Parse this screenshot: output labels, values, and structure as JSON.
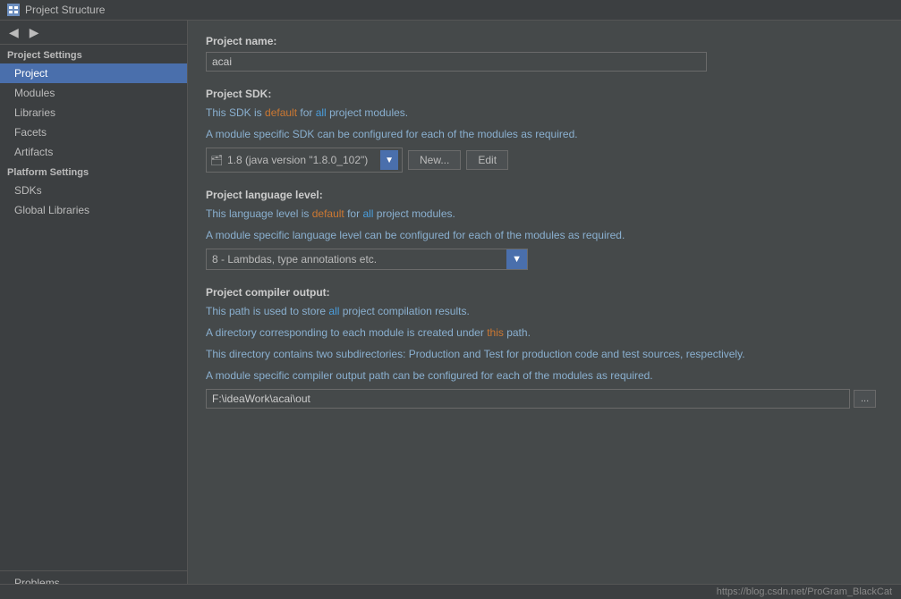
{
  "titleBar": {
    "icon": "project-icon",
    "title": "Project Structure"
  },
  "sidebar": {
    "backBtn": "◀",
    "forwardBtn": "▶",
    "projectSettingsLabel": "Project Settings",
    "items": [
      {
        "id": "project",
        "label": "Project",
        "active": true
      },
      {
        "id": "modules",
        "label": "Modules",
        "active": false
      },
      {
        "id": "libraries",
        "label": "Libraries",
        "active": false
      },
      {
        "id": "facets",
        "label": "Facets",
        "active": false
      },
      {
        "id": "artifacts",
        "label": "Artifacts",
        "active": false
      }
    ],
    "platformSettingsLabel": "Platform Settings",
    "platformItems": [
      {
        "id": "sdks",
        "label": "SDKs",
        "active": false
      },
      {
        "id": "global-libraries",
        "label": "Global Libraries",
        "active": false
      }
    ],
    "problemsLabel": "Problems"
  },
  "content": {
    "projectName": {
      "label": "Project name:",
      "value": "acai"
    },
    "projectSDK": {
      "label": "Project SDK:",
      "desc1": "This SDK is default for all project modules.",
      "desc2": "A module specific SDK can be configured for each of the modules as required.",
      "sdkValue": "1.8 (java version \"1.8.0_102\")",
      "newBtn": "New...",
      "editBtn": "Edit"
    },
    "projectLanguageLevel": {
      "label": "Project language level:",
      "desc1": "This language level is default for all project modules.",
      "desc2": "A module specific language level can be configured for each of the modules as required.",
      "value": "8 - Lambdas, type annotations etc."
    },
    "projectCompilerOutput": {
      "label": "Project compiler output:",
      "desc1": "This path is used to store all project compilation results.",
      "desc2": "A directory corresponding to each module is created under this path.",
      "desc3": "This directory contains two subdirectories: Production and Test for production code and test sources, respectively.",
      "desc4": "A module specific compiler output path can be configured for each of the modules as required.",
      "value": "F:\\ideaWork\\acai\\out",
      "browseBtn": "..."
    }
  },
  "statusBar": {
    "url": "https://blog.csdn.net/ProGram_BlackCat"
  }
}
